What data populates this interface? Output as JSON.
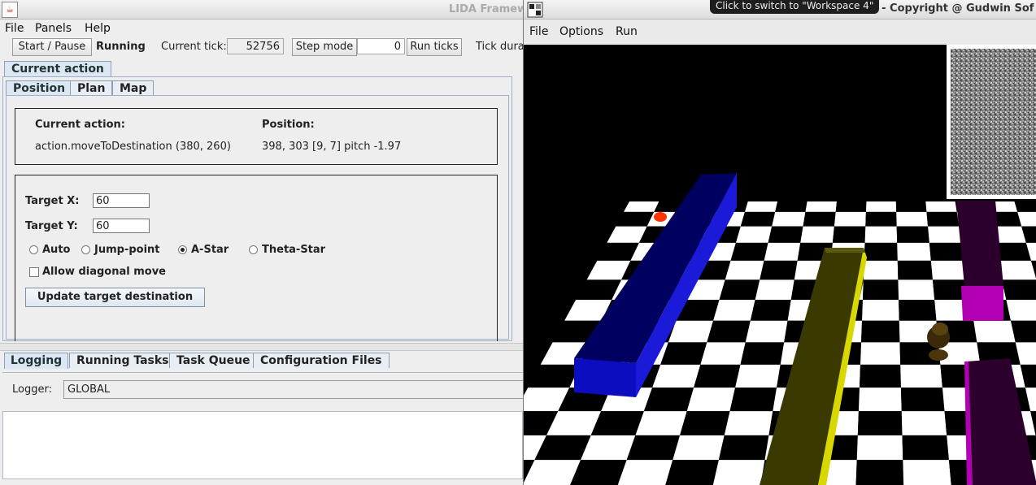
{
  "lida": {
    "title": "LIDA Framew",
    "menu": [
      "File",
      "Panels",
      "Help"
    ],
    "toolbar": {
      "start_pause": "Start / Pause",
      "status": "Running",
      "current_tick_label": "Current tick:",
      "current_tick_value": "52756",
      "step_mode": "Step mode",
      "ticks_value": "0",
      "run_ticks": "Run ticks",
      "tick_duration_label": "Tick dura"
    },
    "top_tab": "Current action",
    "sub_tabs": [
      "Position",
      "Plan",
      "Map"
    ],
    "info": {
      "current_action_label": "Current action:",
      "current_action_value": "action.moveToDestination (380, 260)",
      "position_label": "Position:",
      "position_value": "398, 303 [9, 7] pitch -1.97"
    },
    "form": {
      "target_x_label": "Target X:",
      "target_x_value": "60",
      "target_y_label": "Target Y:",
      "target_y_value": "60",
      "algorithms": [
        "Auto",
        "Jump-point",
        "A-Star",
        "Theta-Star"
      ],
      "selected_algorithm": "A-Star",
      "allow_diagonal_label": "Allow diagonal move",
      "allow_diagonal_checked": false,
      "update_button": "Update target destination"
    },
    "bottom_tabs": [
      "Logging",
      "Running Tasks",
      "Task Queue",
      "Configuration Files"
    ],
    "logger_label": "Logger:",
    "logger_value": "GLOBAL"
  },
  "ws3d": {
    "title": "er 3D - Copyright @ Gudwin Sof",
    "menu": [
      "File",
      "Options",
      "Run"
    ],
    "tooltip": "Click to switch to \"Workspace 4\"",
    "colors": {
      "blue_wall": "#1010c8",
      "yellow_wall": "#d7d700",
      "magenta_wall": "#b000b0",
      "food": "#ff3300"
    }
  }
}
